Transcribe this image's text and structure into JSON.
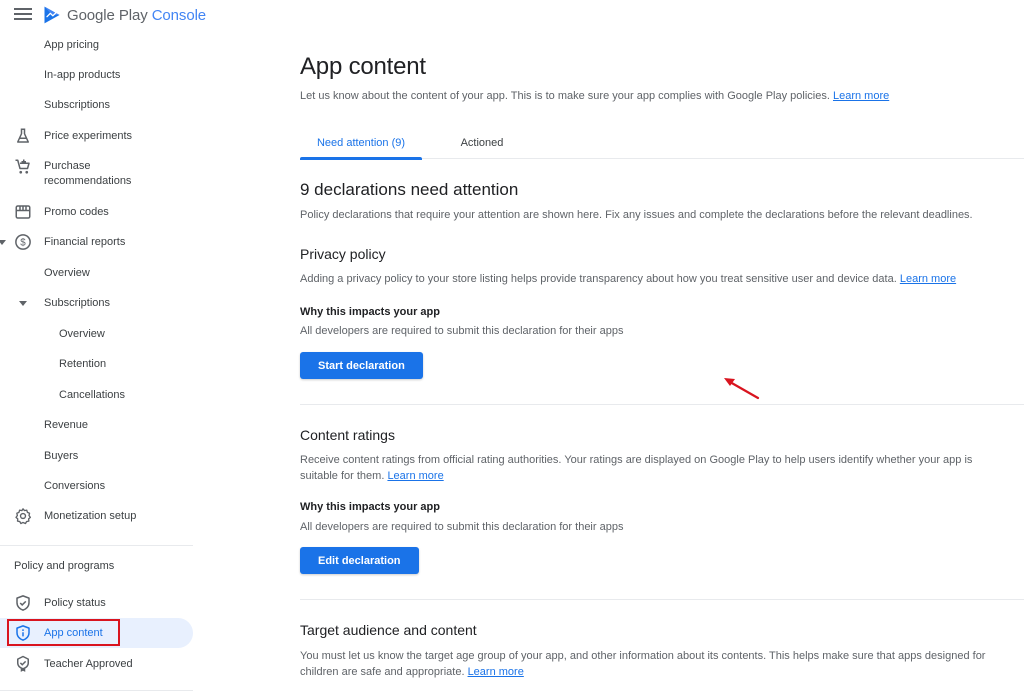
{
  "header": {
    "brand_main": "Google Play",
    "brand_accent": "Console"
  },
  "sidebar": {
    "items": [
      {
        "label": "App pricing"
      },
      {
        "label": "In-app products"
      },
      {
        "label": "Subscriptions"
      },
      {
        "label": "Price experiments",
        "icon": "flask-icon"
      },
      {
        "label": "Purchase",
        "label2": "recommendations",
        "icon": "cart-plus-icon"
      },
      {
        "label": "Promo codes",
        "icon": "storefront-icon"
      },
      {
        "label": "Financial reports",
        "icon": "dollar-circle-icon",
        "expanded": true
      },
      {
        "label": "Overview"
      },
      {
        "label": "Subscriptions",
        "expanded": true
      },
      {
        "label": "Overview"
      },
      {
        "label": "Retention"
      },
      {
        "label": "Cancellations"
      },
      {
        "label": "Revenue"
      },
      {
        "label": "Buyers"
      },
      {
        "label": "Conversions"
      },
      {
        "label": "Monetization setup",
        "icon": "gear-icon"
      }
    ],
    "section_title": "Policy and programs",
    "policy_items": [
      {
        "label": "Policy status",
        "icon": "shield-check-icon"
      },
      {
        "label": "App content",
        "icon": "shield-info-icon",
        "active": true
      },
      {
        "label": "Teacher Approved",
        "icon": "badge-check-icon"
      }
    ]
  },
  "main": {
    "title": "App content",
    "subtitle": "Let us know about the content of your app. This is to make sure your app complies with Google Play policies.",
    "learn_more": "Learn more",
    "tabs": [
      {
        "label": "Need attention (9)",
        "active": true
      },
      {
        "label": "Actioned",
        "active": false
      }
    ],
    "attention_heading": "9 declarations need attention",
    "attention_text": "Policy declarations that require your attention are shown here. Fix any issues and complete the declarations before the relevant deadlines.",
    "sections": [
      {
        "title": "Privacy policy",
        "text": "Adding a privacy policy to your store listing helps provide transparency about how you treat sensitive user and device data.",
        "learn_more": "Learn more",
        "why_title": "Why this impacts your app",
        "why_text": "All developers are required to submit this declaration for their apps",
        "button": "Start declaration"
      },
      {
        "title": "Content ratings",
        "text": "Receive content ratings from official rating authorities. Your ratings are displayed on Google Play to help users identify whether your app is suitable for them.",
        "learn_more": "Learn more",
        "why_title": "Why this impacts your app",
        "why_text": "All developers are required to submit this declaration for their apps",
        "button": "Edit declaration"
      },
      {
        "title": "Target audience and content",
        "text": "You must let us know the target age group of your app, and other information about its contents. This helps make sure that apps designed for children are safe and appropriate.",
        "learn_more": "Learn more"
      }
    ]
  },
  "colors": {
    "accent": "#1a73e8",
    "annotation": "#d9141f",
    "active_bg": "#e8f0fe"
  }
}
